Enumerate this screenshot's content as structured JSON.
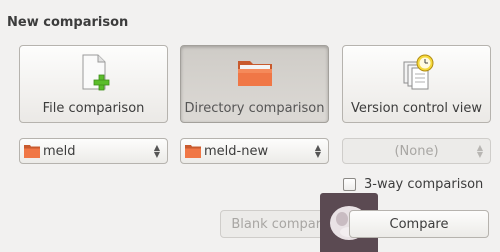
{
  "heading": "New comparison",
  "buttons": {
    "file": {
      "label": "File comparison",
      "icon": "file-add-icon"
    },
    "directory": {
      "label": "Directory comparison",
      "icon": "folder-icon",
      "active": true
    },
    "vc": {
      "label": "Version control view",
      "icon": "version-control-icon"
    }
  },
  "combos": {
    "first": {
      "value": "meld",
      "icon": "folder-icon"
    },
    "second": {
      "value": "meld-new",
      "icon": "folder-icon"
    },
    "third": {
      "value": "(None)",
      "disabled": true
    }
  },
  "three_way": {
    "label": "3-way comparison",
    "checked": false
  },
  "actions": {
    "blank": {
      "label": "Blank comparison",
      "disabled": true
    },
    "compare": {
      "label": "Compare"
    }
  },
  "colors": {
    "background": "#f2f1f0",
    "folder_orange": "#f07746",
    "plus_green": "#5bbd2b"
  }
}
